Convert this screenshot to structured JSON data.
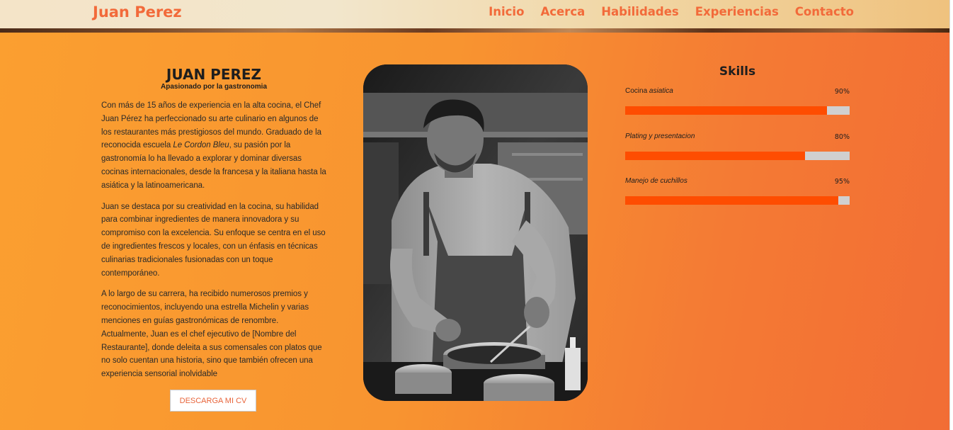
{
  "header": {
    "brand": "Juan Perez",
    "nav": [
      "Inicio",
      "Acerca",
      "Habilidades",
      "Experiencias",
      "Contacto"
    ]
  },
  "about": {
    "name": "JUAN PEREZ",
    "subtitle": "Apasionado por la gastronomia",
    "p1_a": "Con más de 15 años de experiencia en la alta cocina, el Chef Juan Pérez ha perfeccionado su arte culinario en algunos de los restaurantes más prestigiosos del mundo. Graduado de la reconocida escuela ",
    "p1_em": "Le Cordon Bleu",
    "p1_b": ", su pasión por la gastronomía lo ha llevado a explorar y dominar diversas cocinas internacionales, desde la francesa y la italiana hasta la asiática y la latinoamericana.",
    "p2": "Juan se destaca por su creatividad en la cocina, su habilidad para combinar ingredientes de manera innovadora y su compromiso con la excelencia. Su enfoque se centra en el uso de ingredientes frescos y locales, con un énfasis en técnicas culinarias tradicionales fusionadas con un toque contemporáneo.",
    "p3": "A lo largo de su carrera, ha recibido numerosos premios y reconocimientos, incluyendo una estrella Michelin y varias menciones en guías gastronómicas de renombre. Actualmente, Juan es el chef ejecutivo de [Nombre del Restaurante], donde deleita a sus comensales con platos que no solo cuentan una historia, sino que también ofrecen una experiencia sensorial inolvidable",
    "cv_button": "DESCARGA MI CV"
  },
  "skills": {
    "title": "Skills",
    "items": [
      {
        "name_plain": "Cocina ",
        "name_italic": "asiatica",
        "percent_label": "90%",
        "level": 0.9
      },
      {
        "name_plain": "",
        "name_italic": "Plating y presentacion",
        "percent_label": "80%",
        "level": 0.8
      },
      {
        "name_plain": "",
        "name_italic": "Manejo de cuchillos",
        "percent_label": "95%",
        "level": 0.95
      }
    ]
  },
  "colors": {
    "accent": "#f26a3a",
    "bar_fill": "#fe4d01",
    "bar_track": "#d0d0d0"
  }
}
